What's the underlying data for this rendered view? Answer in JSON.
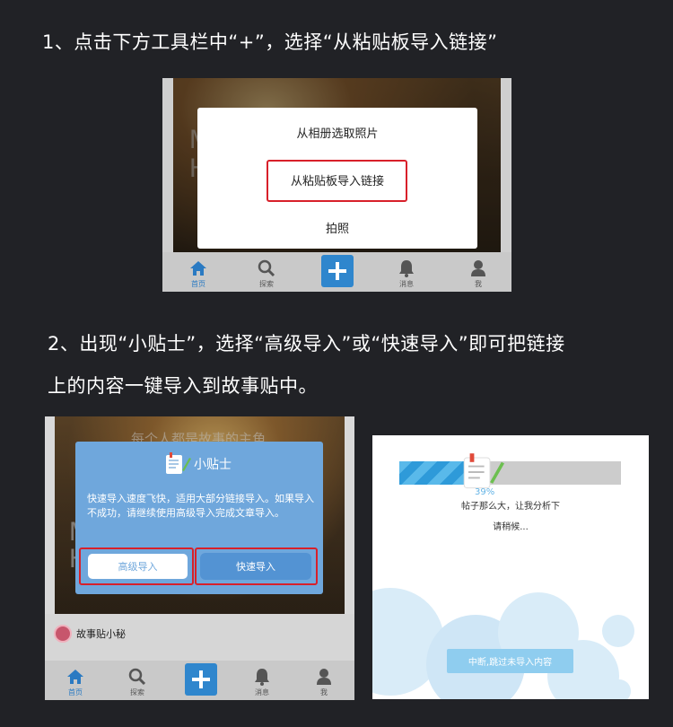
{
  "step1": "1、点击下方工具栏中“+”，选择“从粘贴板导入链接”",
  "step2_line1": "2、出现“小贴士”，选择“高级导入”或“快速导入”即可把链接",
  "step2_line2": "上的内容一键导入到故事贴中。",
  "tabbar": {
    "home": "首页",
    "explore": "探索",
    "messages": "消息",
    "me": "我"
  },
  "menu": {
    "from_album": "从相册选取照片",
    "from_clipboard": "从粘贴板导入链接",
    "camera": "拍照"
  },
  "tip": {
    "background_text": "每个人都是故事的主角",
    "title": "小贴士",
    "body": "快速导入速度飞快，适用大部分链接导入。如果导入不成功，请继续使用高级导入完成文章导入。",
    "advanced_button": "高级导入",
    "quick_button": "快速导入"
  },
  "author": {
    "name": "故事贴小秘"
  },
  "loading": {
    "percent": "39%",
    "progress_fraction": 0.39,
    "message": "帖子那么大，让我分析下",
    "wait": "请稍候...",
    "skip_button": "中断,跳过未导入内容"
  },
  "colors": {
    "background": "#212226",
    "accent_blue": "#2f86cd",
    "highlight_red": "#d8202a",
    "tip_blue": "#6fa7dc"
  }
}
